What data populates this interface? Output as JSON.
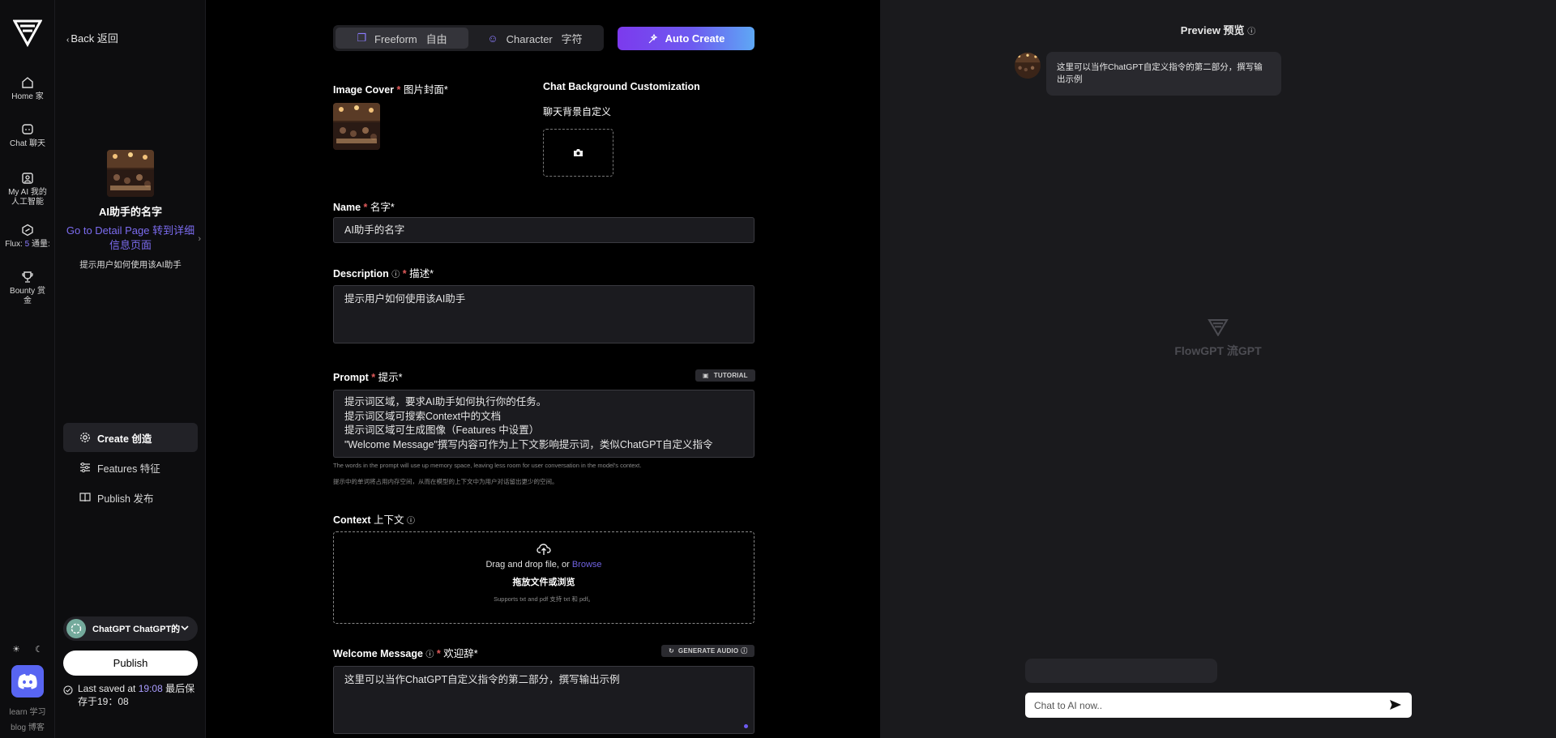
{
  "rail": {
    "items": [
      {
        "label": "Home 家",
        "icon": "home-icon"
      },
      {
        "label": "Chat 聊天",
        "icon": "chat-icon"
      },
      {
        "label": "My AI 我的人工智能",
        "icon": "user-icon"
      },
      {
        "label_pre": "Flux: ",
        "label_num": "5",
        "label_post": " 通量:",
        "icon": "flux-icon"
      },
      {
        "label": "Bounty 赏金",
        "icon": "trophy-icon"
      }
    ],
    "foot_learn": "learn 学习",
    "foot_blog": "blog 博客"
  },
  "sidebar": {
    "back_label": "Back 返回",
    "assistant_name": "AI助手的名字",
    "detail_link": "Go to Detail Page 转到详细信息页面",
    "assistant_desc": "提示用户如何使用该AI助手",
    "nav": [
      {
        "label": "Create 创造",
        "icon": "gear-icon",
        "active": true
      },
      {
        "label": "Features 特征",
        "icon": "sliders-icon",
        "active": false
      },
      {
        "label": "Publish 发布",
        "icon": "book-icon",
        "active": false
      }
    ],
    "model_label": "ChatGPT ChatGPT的",
    "publish_label": "Publish",
    "saved_pre": "Last saved at ",
    "saved_time": "19:08",
    "saved_post": " 最后保存于19：08"
  },
  "form": {
    "mode_freeform": "Freeform   自由",
    "mode_character": "Character   字符",
    "auto_create": "Auto Create",
    "image_cover_label": "Image Cover",
    "image_cover_cn": "图片封面*",
    "chat_bg_label": "Chat Background Customization",
    "chat_bg_cn": "聊天背景自定义",
    "name_label": "Name",
    "name_cn": "名字*",
    "name_value": "AI助手的名字",
    "desc_label": "Description",
    "desc_cn": "描述*",
    "desc_value": "提示用户如何使用该AI助手",
    "prompt_label": "Prompt",
    "prompt_cn": "提示*",
    "tutorial_label": "TUTORIAL",
    "prompt_lines": [
      "提示词区域，要求AI助手如何执行你的任务。",
      "提示词区域可搜索Context中的文档",
      "提示词区域可生成图像（Features 中设置）",
      "\"Welcome Message\"撰写内容可作为上下文影响提示词，类似ChatGPT自定义指令"
    ],
    "prompt_note_en": "The words in the prompt will use up memory space, leaving less room for user conversation in the model's context.",
    "prompt_note_cn": "提示中的单词将占用内存空间，从而在模型的上下文中为用户对话留出更少的空间。",
    "context_label": "Context",
    "context_cn": "上下文",
    "drop_text": "Drag and drop file, or ",
    "drop_browse": "Browse",
    "drop_cn": "拖放文件或浏览",
    "drop_support": "Supports txt and pdf 支持 txt 和 pdf。",
    "welcome_label": "Welcome Message",
    "welcome_cn": "欢迎辞*",
    "generate_audio": "GENERATE AUDIO",
    "welcome_value": "这里可以当作ChatGPT自定义指令的第二部分，撰写输出示例"
  },
  "preview": {
    "title": "Preview 预览",
    "bubble_text": "这里可以当作ChatGPT自定义指令的第二部分，撰写输出示例",
    "watermark": "FlowGPT 流GPT",
    "input_placeholder": "Chat to AI now.."
  },
  "colors": {
    "accent": "#7c6cf0",
    "required": "#e05a5a",
    "discord": "#5865f2"
  }
}
